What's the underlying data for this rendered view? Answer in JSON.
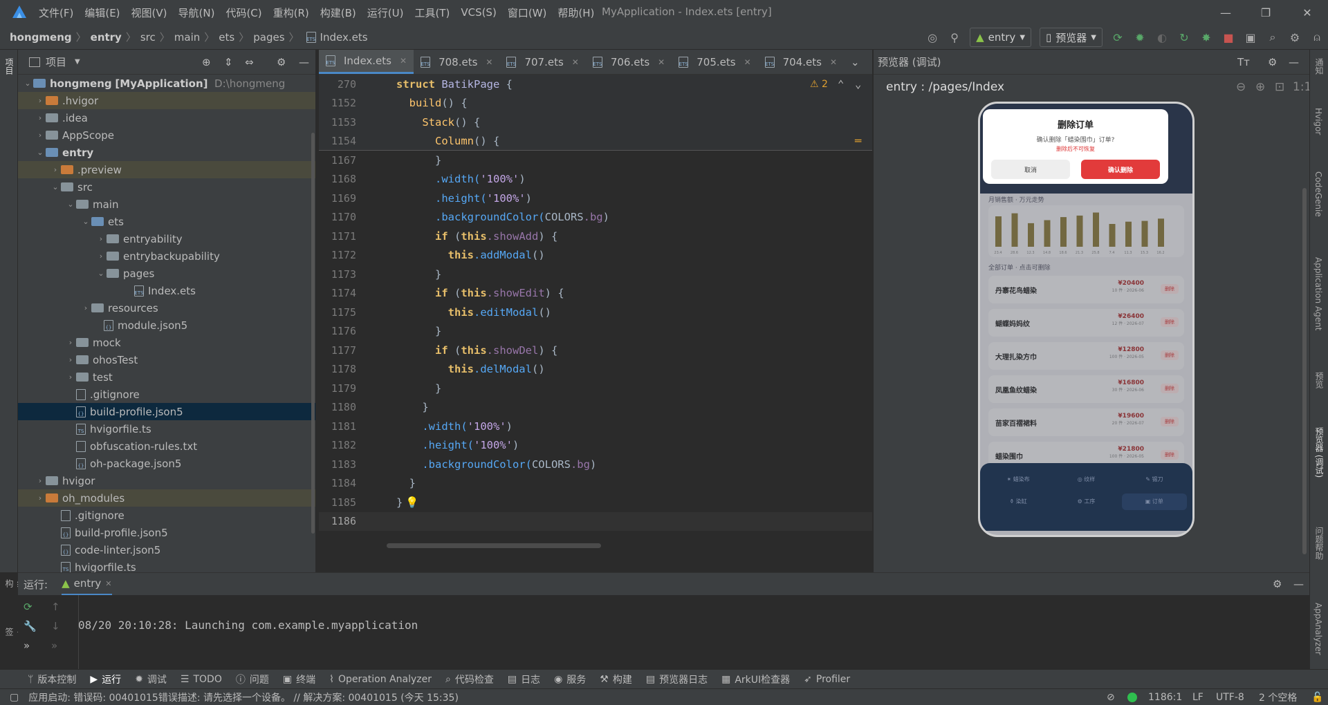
{
  "titlebar": {
    "menus": [
      "文件(F)",
      "编辑(E)",
      "视图(V)",
      "导航(N)",
      "代码(C)",
      "重构(R)",
      "构建(B)",
      "运行(U)",
      "工具(T)",
      "VCS(S)",
      "窗口(W)",
      "帮助(H)"
    ],
    "title": "MyApplication - Index.ets [entry]"
  },
  "breadcrumb": [
    "hongmeng",
    "entry",
    "src",
    "main",
    "ets",
    "pages",
    "Index.ets"
  ],
  "toolbar": {
    "run_config": "entry",
    "device": "预览器"
  },
  "project": {
    "header": "项目",
    "root_name": "hongmeng",
    "root_module": "[MyApplication]",
    "root_path": "D:\\hongmeng",
    "nodes": [
      ".hvigor",
      ".idea",
      "AppScope",
      "entry",
      ".preview",
      "src",
      "main",
      "ets",
      "entryability",
      "entrybackupability",
      "pages",
      "Index.ets",
      "resources",
      "module.json5",
      "mock",
      "ohosTest",
      "test",
      ".gitignore",
      "build-profile.json5",
      "hvigorfile.ts",
      "obfuscation-rules.txt",
      "oh-package.json5",
      "hvigor",
      "oh_modules",
      ".gitignore",
      "build-profile.json5",
      "code-linter.json5",
      "hvigorfile.ts"
    ]
  },
  "tabs": [
    "Index.ets",
    "708.ets",
    "707.ets",
    "706.ets",
    "705.ets",
    "704.ets"
  ],
  "editor": {
    "warnings": "2",
    "line_numbers": [
      "270",
      "1152",
      "1153",
      "1154",
      "1167",
      "1168",
      "1169",
      "1170",
      "1171",
      "1172",
      "1173",
      "1174",
      "1175",
      "1176",
      "1177",
      "1178",
      "1179",
      "1180",
      "1181",
      "1182",
      "1183",
      "1184",
      "1185",
      "1186"
    ],
    "sticky": {
      "l270_a": "struct",
      "l270_b": "BatikPage",
      "l270_c": " {",
      "l1152_a": "build",
      "l1152_b": "() {",
      "l1153_a": "Stack",
      "l1153_b": "() {",
      "l1154_a": "Column",
      "l1154_b": "() {"
    },
    "lines": {
      "l1167": "}",
      "w": ".width(",
      "w100": "'100%'",
      "close": ")",
      "h": ".height(",
      "bg": ".backgroundColor(",
      "colors": "COLORS",
      "dotbg": ".bg",
      "if": "if",
      "this": "this",
      "showAdd": ".showAdd",
      "showEdit": ".showEdit",
      "showDel": ".showDel",
      "addModal": ".addModal",
      "editModal": ".editModal",
      "delModal": ".delModal",
      "paren_open": " (",
      "paren_brace": ") {",
      "call": "()",
      "brace_close": "}",
      "brace_close2": "}"
    }
  },
  "preview": {
    "header": "预览器 (调试)",
    "route": "entry : /pages/Index",
    "dialog": {
      "title": "删除订单",
      "message": "确认删除「蜡染围巾」订单?",
      "warning": "删除后不可恢复",
      "cancel": "取消",
      "confirm": "确认删除"
    },
    "chart": {
      "label": "月销售额 · 万元走势",
      "bars": [
        0.8,
        0.88,
        0.62,
        0.7,
        0.78,
        0.82,
        0.9,
        0.6,
        0.66,
        0.68,
        0.74
      ],
      "bar_labels": [
        "23.4",
        "28.6",
        "12.3",
        "14.8",
        "18.6",
        "21.3",
        "25.8",
        "7.4",
        "11.3",
        "15.3",
        "16.2"
      ]
    },
    "section_label": "全部订单 · 点击可删除",
    "orders": [
      {
        "name": "丹寨花鸟蜡染",
        "price": "¥20400",
        "meta": "10 件 · 2026-06",
        "tag": "删除"
      },
      {
        "name": "蝴蝶妈妈纹",
        "price": "¥26400",
        "meta": "12 件 · 2026-07",
        "tag": "删除"
      },
      {
        "name": "大理扎染方巾",
        "price": "¥12800",
        "meta": "100 件 · 2026-05",
        "tag": "删除"
      },
      {
        "name": "凤凰鱼纹蜡染",
        "price": "¥16800",
        "meta": "30 件 · 2026-06",
        "tag": "删除"
      },
      {
        "name": "苗家百褶裙料",
        "price": "¥19600",
        "meta": "20 件 · 2026-07",
        "tag": "删除"
      },
      {
        "name": "蜡染围巾",
        "price": "¥21800",
        "meta": "100 件 · 2026-05",
        "tag": "删除"
      }
    ],
    "nav": [
      "蜡染布",
      "纹样",
      "锡刀",
      "染缸",
      "工序",
      "订单"
    ]
  },
  "run": {
    "label": "运行:",
    "tab": "entry",
    "log": "08/20 20:10:28: Launching com.example.myapplication"
  },
  "bottom_tools": [
    "版本控制",
    "运行",
    "调试",
    "TODO",
    "问题",
    "终端",
    "Operation Analyzer",
    "代码检查",
    "日志",
    "服务",
    "构建",
    "预览器日志",
    "ArkUI检查器",
    "Profiler"
  ],
  "status": {
    "message": "应用启动: 错误码: 00401015错误描述: 请先选择一个设备。 // 解决方案: 00401015 (今天 15:35)",
    "position": "1186:1",
    "line_sep": "LF",
    "encoding": "UTF-8",
    "indent": "2 个空格"
  },
  "right_tools": [
    "通知",
    "Hvigor",
    "CodeGenie",
    "Application Agent",
    "预览",
    "预览器 (调试)",
    "问题帮助",
    "AppAnalyzer"
  ],
  "left_tools": [
    "项目",
    "结构",
    "书签"
  ]
}
